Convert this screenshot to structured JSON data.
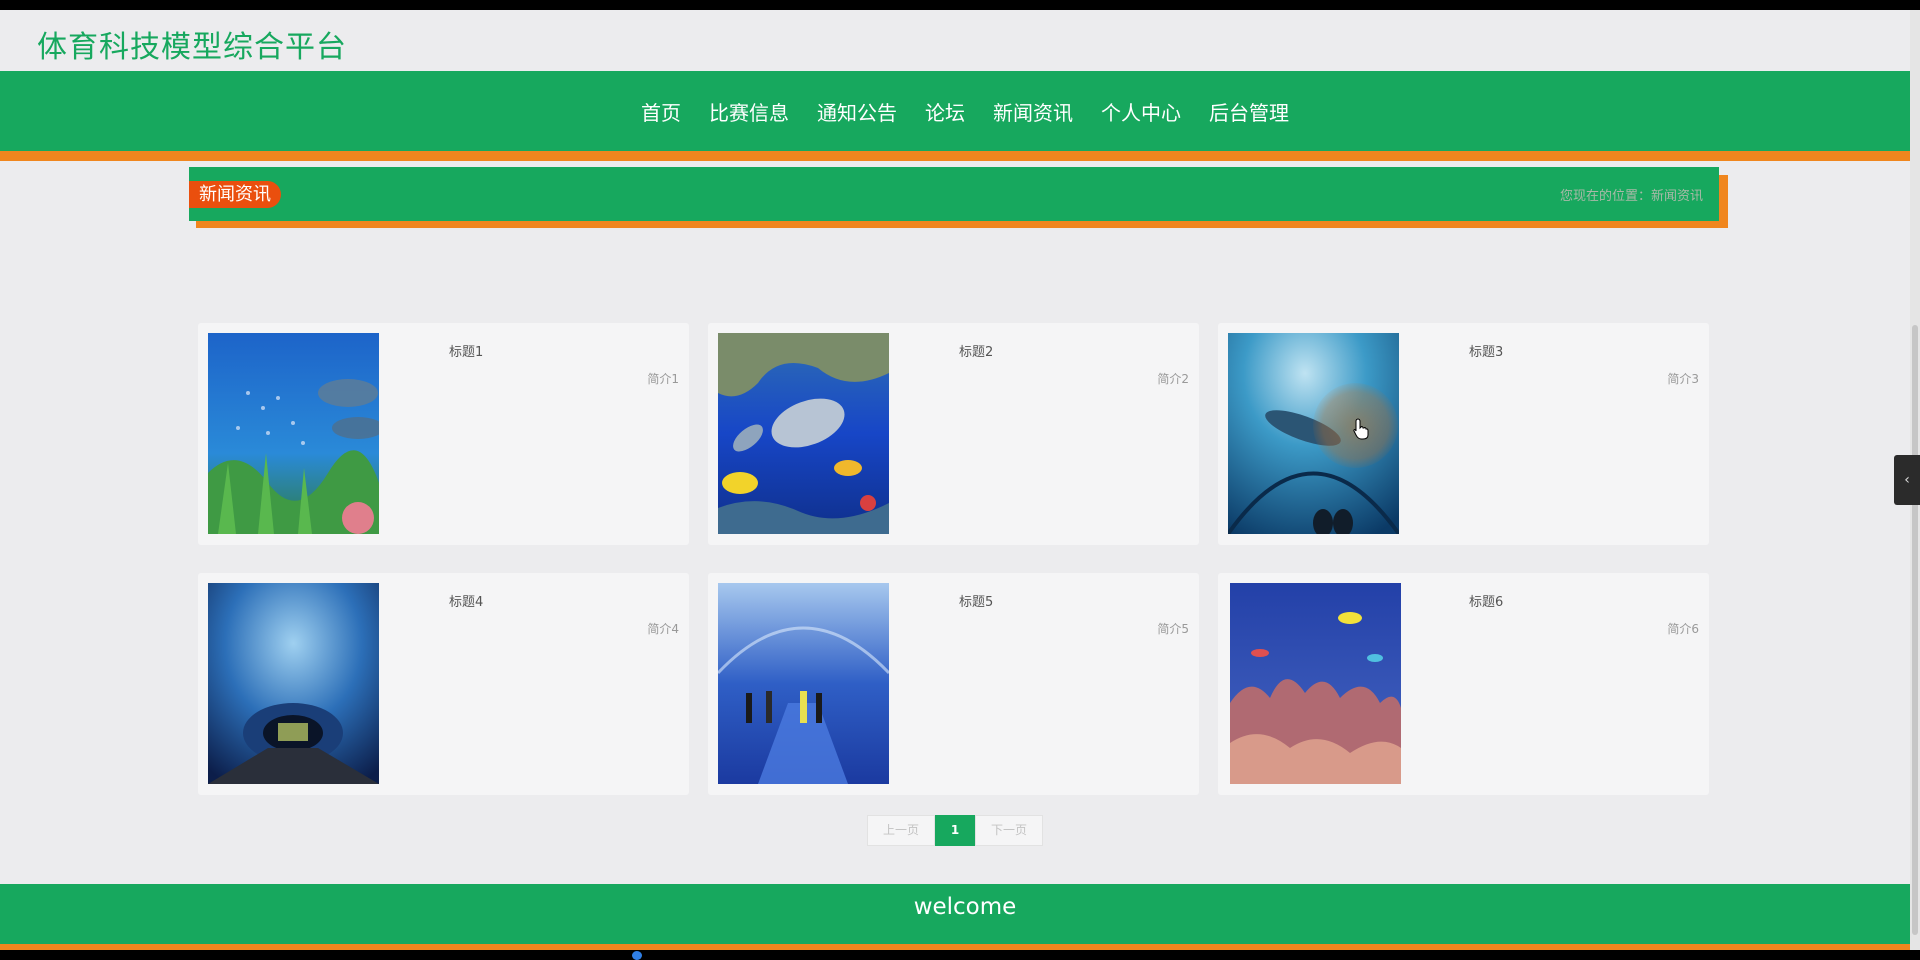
{
  "site": {
    "title": "体育科技模型综合平台"
  },
  "nav": {
    "items": [
      {
        "label": "首页"
      },
      {
        "label": "比赛信息"
      },
      {
        "label": "通知公告"
      },
      {
        "label": "论坛"
      },
      {
        "label": "新闻资讯"
      },
      {
        "label": "个人中心"
      },
      {
        "label": "后台管理"
      }
    ]
  },
  "section": {
    "tag": "新闻资讯",
    "breadcrumb": "您现在的位置：新闻资讯"
  },
  "news": [
    {
      "title": "标题1",
      "intro": "简介1",
      "image": "reef-fish-dolphins"
    },
    {
      "title": "标题2",
      "intro": "简介2",
      "image": "dolphin-cave"
    },
    {
      "title": "标题3",
      "intro": "简介3",
      "image": "aquarium-tunnel-shark"
    },
    {
      "title": "标题4",
      "intro": "简介4",
      "image": "underwater-tunnel-walkway"
    },
    {
      "title": "标题5",
      "intro": "简介5",
      "image": "aquarium-tunnel-visitors"
    },
    {
      "title": "标题6",
      "intro": "简介6",
      "image": "coral-reef"
    }
  ],
  "pagination": {
    "prev": "上一页",
    "current": "1",
    "next": "下一页"
  },
  "footer": {
    "text": "welcome"
  },
  "colors": {
    "primary": "#17a85e",
    "accent": "#f0861e",
    "tag": "#ea4f0e"
  }
}
